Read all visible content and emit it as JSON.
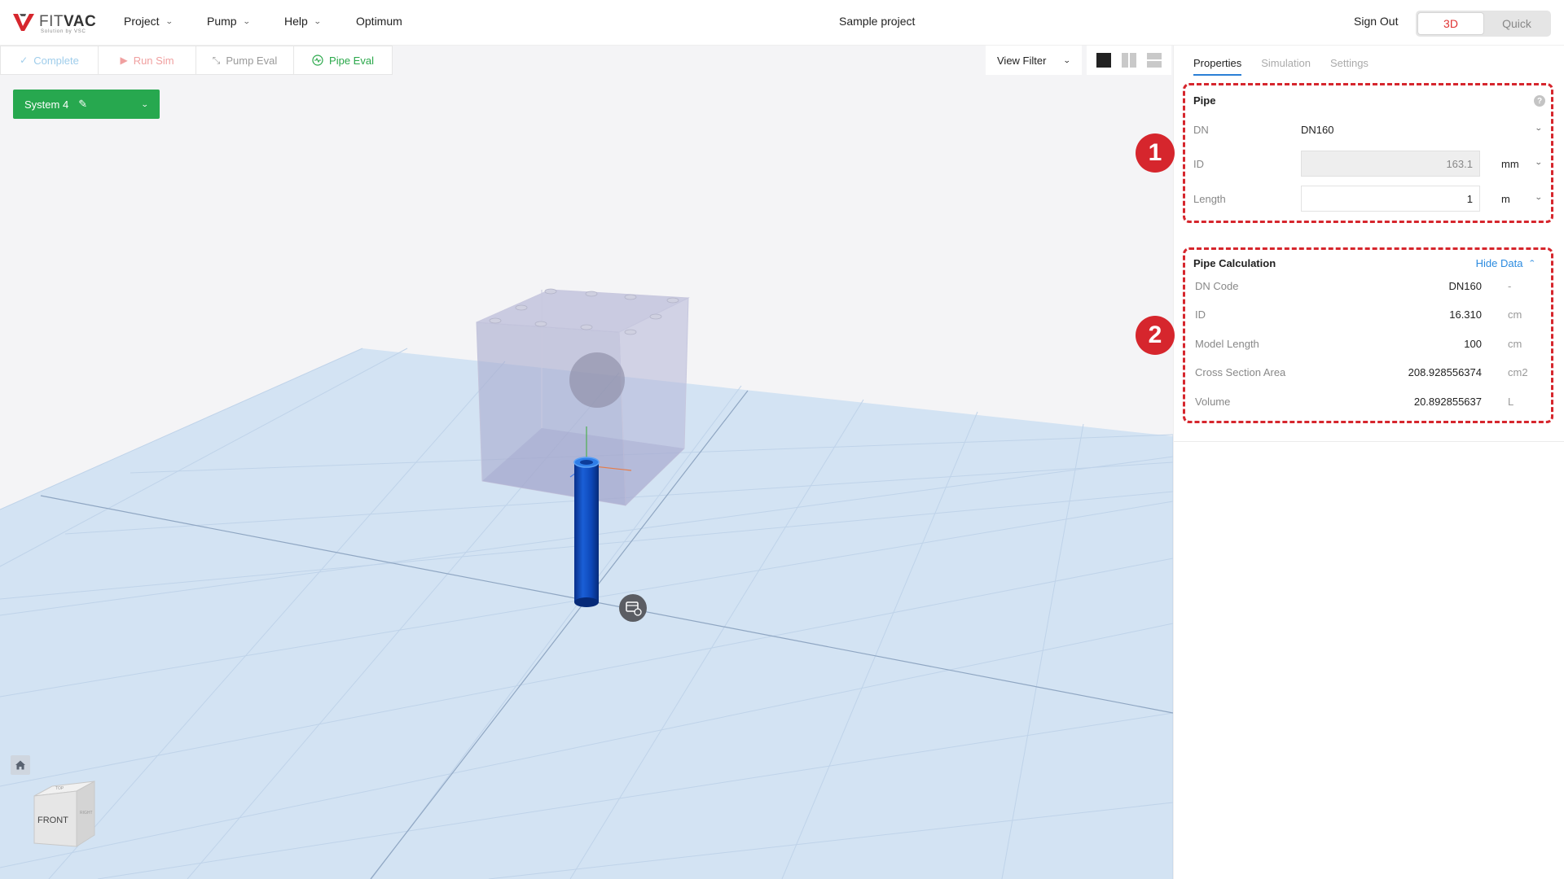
{
  "app": {
    "logo_text": "FITVAC",
    "logo_fit": "FIT",
    "logo_vac": "VAC",
    "logo_tagline": "Solution by VSC"
  },
  "menu": [
    {
      "label": "Project"
    },
    {
      "label": "Pump"
    },
    {
      "label": "Help"
    },
    {
      "label": "Optimum"
    }
  ],
  "project_title": "Sample project",
  "sign_out": "Sign Out",
  "view_toggle": {
    "options": [
      "3D",
      "Quick"
    ],
    "active": "3D"
  },
  "toolbar": {
    "complete": "Complete",
    "run_sim": "Run Sim",
    "pump_eval": "Pump Eval",
    "pipe_eval": "Pipe Eval"
  },
  "view_filter": "View Filter",
  "system_button": "System 4",
  "navcube": {
    "front": "FRONT",
    "top": "TOP",
    "right": "RIGHT"
  },
  "panel": {
    "tabs": [
      "Properties",
      "Simulation",
      "Settings"
    ],
    "active_tab": "Properties",
    "pipe": {
      "title": "Pipe",
      "dn_label": "DN",
      "dn_value": "DN160",
      "id_label": "ID",
      "id_value": "163.1",
      "id_unit": "mm",
      "length_label": "Length",
      "length_value": "1",
      "length_unit": "m"
    },
    "calc": {
      "title": "Pipe Calculation",
      "toggle_label": "Hide Data",
      "rows": [
        {
          "label": "DN Code",
          "value": "DN160",
          "unit": "-"
        },
        {
          "label": "ID",
          "value": "16.310",
          "unit": "cm"
        },
        {
          "label": "Model Length",
          "value": "100",
          "unit": "cm"
        },
        {
          "label": "Cross Section Area",
          "value": "208.928556374",
          "unit": "cm2"
        },
        {
          "label": "Volume",
          "value": "20.892855637",
          "unit": "L"
        }
      ]
    }
  },
  "annotations": [
    "1",
    "2"
  ],
  "colors": {
    "accent_red": "#d6262d",
    "system_green": "#27a84f",
    "tab_blue": "#2b7fd6",
    "pipe_blue": "#0d47b8"
  }
}
